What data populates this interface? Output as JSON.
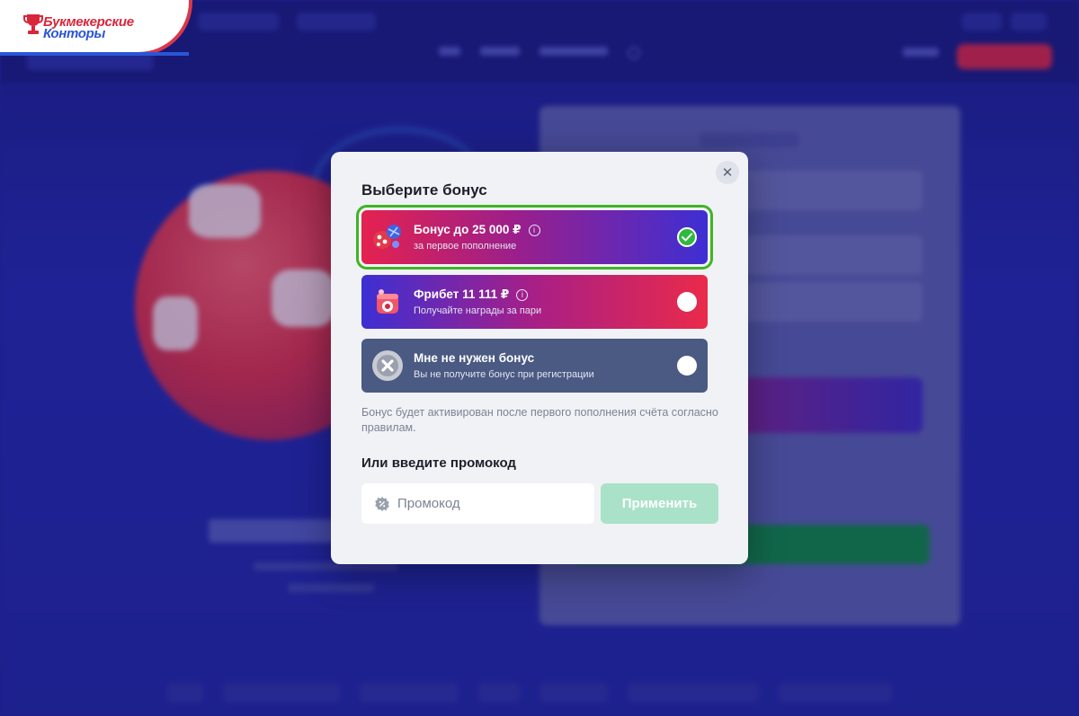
{
  "brand": {
    "line1": "Букмекерские",
    "line2": "Конторы"
  },
  "modal": {
    "title": "Выберите бонус",
    "close_symbol": "✕",
    "options": [
      {
        "title": "Бонус до 25 000 ₽",
        "subtitle": "за первое пополнение",
        "icon": "gift-balls-icon",
        "selected": true
      },
      {
        "title": "Фрибет 11 111 ₽",
        "subtitle": "Получайте награды за пари",
        "icon": "freebet-box-icon",
        "selected": false
      },
      {
        "title": "Мне не нужен бонус",
        "subtitle": "Вы не получите бонус при регистрации",
        "icon": "no-bonus-icon",
        "selected": false
      }
    ],
    "note": "Бонус будет активирован после первого пополнения счёта согласно правилам.",
    "promo_title": "Или введите промокод",
    "promo_placeholder": "Промокод",
    "apply_label": "Применить"
  },
  "colors": {
    "selected_outline": "#3fb524",
    "apply_button": "#a9e2c8",
    "background": "#23239a"
  }
}
